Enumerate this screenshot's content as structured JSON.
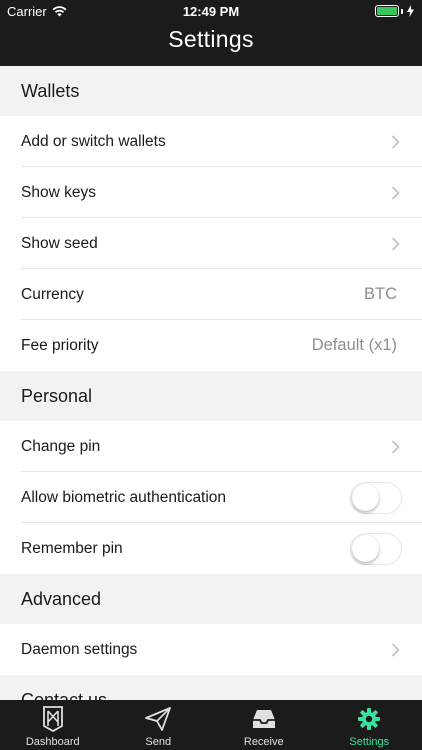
{
  "status_bar": {
    "carrier": "Carrier",
    "time": "12:49 PM",
    "battery_color": "#34c759"
  },
  "header": {
    "title": "Settings"
  },
  "sections": [
    {
      "title": "Wallets",
      "rows": [
        {
          "label": "Add or switch wallets",
          "accessory": "chevron"
        },
        {
          "label": "Show keys",
          "accessory": "chevron"
        },
        {
          "label": "Show seed",
          "accessory": "chevron"
        },
        {
          "label": "Currency",
          "value": "BTC"
        },
        {
          "label": "Fee priority",
          "value": "Default (x1)"
        }
      ]
    },
    {
      "title": "Personal",
      "rows": [
        {
          "label": "Change pin",
          "accessory": "chevron"
        },
        {
          "label": "Allow biometric authentication",
          "accessory": "toggle",
          "on": false
        },
        {
          "label": "Remember pin",
          "accessory": "toggle",
          "on": false
        }
      ]
    },
    {
      "title": "Advanced",
      "rows": [
        {
          "label": "Daemon settings",
          "accessory": "chevron"
        }
      ]
    },
    {
      "title": "Contact us",
      "rows": []
    }
  ],
  "tabbar": {
    "active_color": "#3ce0a0",
    "tabs": [
      {
        "label": "Dashboard",
        "icon": "dashboard-logo-icon"
      },
      {
        "label": "Send",
        "icon": "paper-plane-icon"
      },
      {
        "label": "Receive",
        "icon": "inbox-tray-icon"
      },
      {
        "label": "Settings",
        "icon": "gear-icon",
        "active": true
      }
    ]
  }
}
